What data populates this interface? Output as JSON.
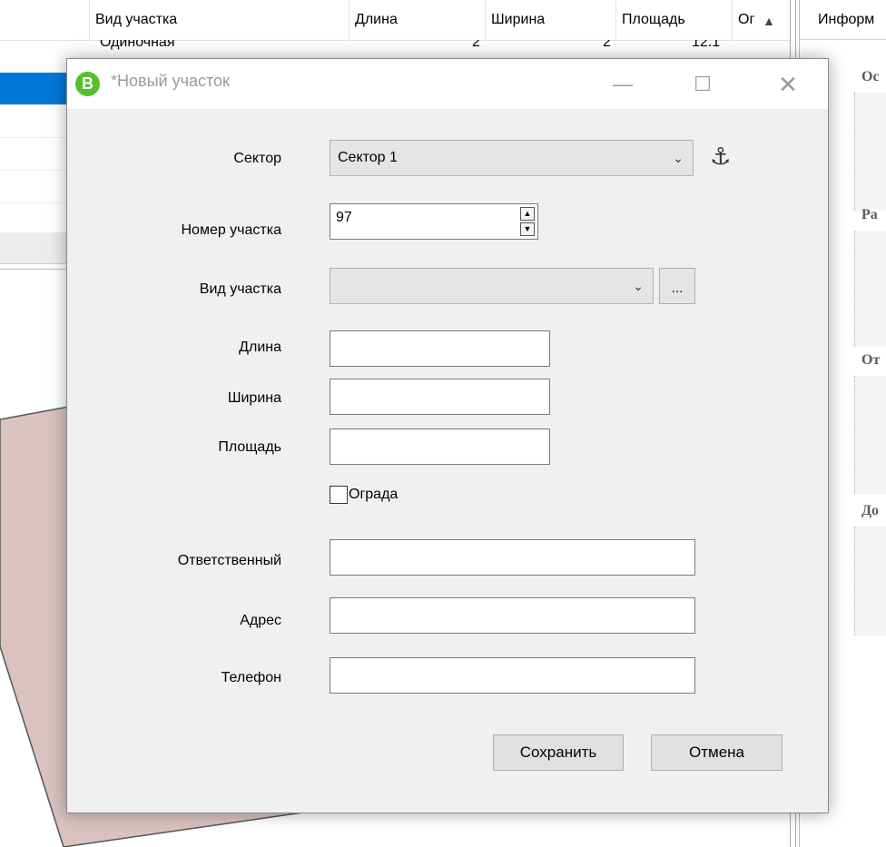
{
  "background": {
    "grid": {
      "columns": [
        "Вид участка",
        "Длина",
        "Ширина",
        "Площадь",
        "Ог"
      ],
      "partial_row": {
        "type": "Одиночная",
        "length": "2",
        "width": "2",
        "area": "12.1"
      },
      "scroll_up_symbol": "▲"
    },
    "right_panel": {
      "header": "Информ",
      "groups": [
        "Ос",
        "Ра",
        "От",
        "До"
      ]
    },
    "polygon_color": "#d9c2bf"
  },
  "dialog": {
    "logo_letter": "B",
    "title": "*Новый участок",
    "controls": {
      "minimize": "—",
      "maximize": "☐",
      "close": "✕"
    },
    "form": {
      "sector_label": "Сектор",
      "sector_value": "Сектор 1",
      "anchor_symbol": "⚓",
      "plot_number_label": "Номер участка",
      "plot_number_value": "97",
      "plot_type_label": "Вид участка",
      "plot_type_value": "",
      "browse_label": "...",
      "length_label": "Длина",
      "length_value": "",
      "width_label": "Ширина",
      "width_value": "",
      "area_label": "Площадь",
      "area_value": "",
      "fence_label": "Ограда",
      "fence_checked": false,
      "responsible_label": "Ответственный",
      "responsible_value": "",
      "address_label": "Адрес",
      "address_value": "",
      "phone_label": "Телефон",
      "phone_value": ""
    },
    "buttons": {
      "save": "Сохранить",
      "cancel": "Отмена"
    }
  }
}
